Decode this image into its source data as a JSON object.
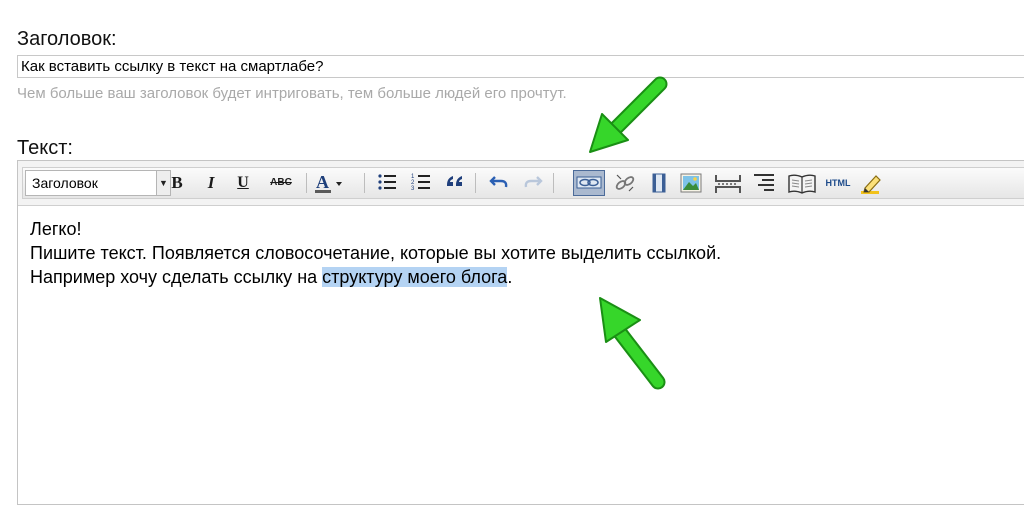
{
  "form": {
    "title_label": "Заголовок:",
    "title_value": "Как вставить ссылку в текст на смартлабе?",
    "title_hint": "Чем больше ваш заголовок будет интриговать, тем больше людей его прочтут.",
    "text_label": "Текст:"
  },
  "toolbar": {
    "format_value": "Заголовок",
    "strike_label": "ABC",
    "color_label": "A",
    "html_label": "HTML"
  },
  "content": {
    "line1": "Легко!",
    "line2": "Пишите текст. Появляется словосочетание, которые вы хотите выделить ссылкой.",
    "line3_prefix": "Например хочу сделать ссылку на ",
    "line3_selected": "структуру моего блога",
    "line3_suffix": "."
  },
  "colors": {
    "arrow": "#22c41a",
    "selection": "#b4d3f3"
  }
}
